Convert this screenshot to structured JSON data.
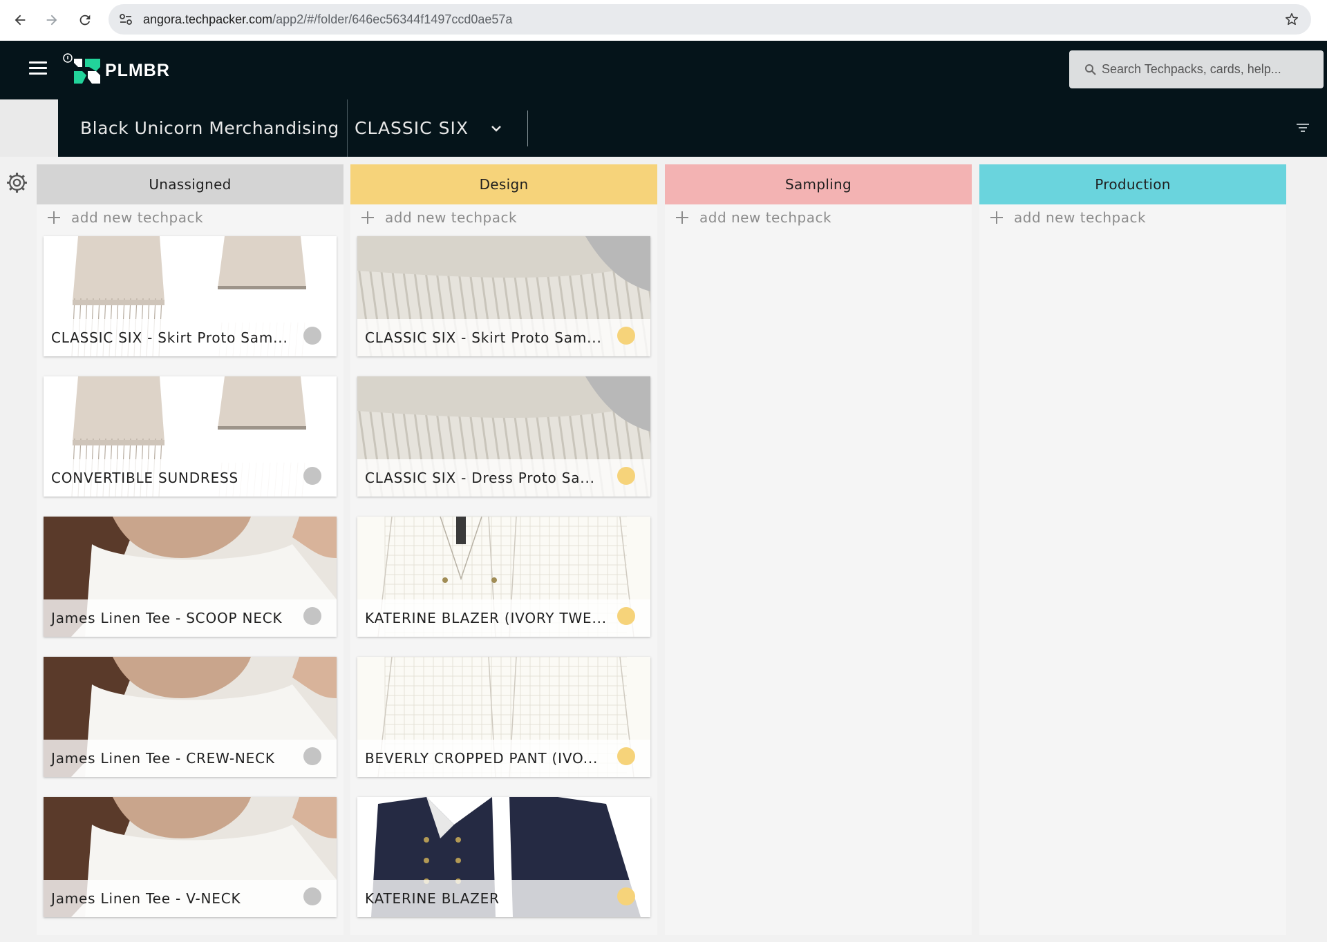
{
  "browser": {
    "url_host": "angora.techpacker.com",
    "url_path": "/app2/#/folder/646ec56344f1497ccd0ae57a"
  },
  "app": {
    "brand": "PLMBR",
    "search_placeholder": "Search Techpacks, cards, help..."
  },
  "folder": {
    "title": "Black Unicorn Merchandising",
    "collection": "CLASSIC SIX"
  },
  "colors": {
    "unassigned": "#d4d4d4",
    "design": "#f6d37a",
    "sampling": "#f3b3b3",
    "production": "#6ad4dd",
    "status_grey": "#c4c4c4",
    "status_yellow": "#f6d37a"
  },
  "add_label": "add new techpack",
  "columns": [
    {
      "label": "Unassigned",
      "cards": [
        {
          "title": "CLASSIC SIX - Skirt Proto Sam...",
          "image": "skirt-sketch"
        },
        {
          "title": "CONVERTIBLE SUNDRESS",
          "image": "dress-sketch"
        },
        {
          "title": "James Linen Tee - SCOOP NECK",
          "image": "photo-tee"
        },
        {
          "title": "James Linen Tee - CREW-NECK",
          "image": "photo-tee"
        },
        {
          "title": "James Linen Tee - V-NECK",
          "image": "photo-tee"
        }
      ]
    },
    {
      "label": "Design",
      "cards": [
        {
          "title": "CLASSIC SIX - Skirt Proto Sam...",
          "image": "photo-pleats"
        },
        {
          "title": "CLASSIC SIX - Dress Proto Sa...",
          "image": "photo-pleats"
        },
        {
          "title": "KATERINE BLAZER (IVORY TWE...",
          "image": "blazer-ivory"
        },
        {
          "title": "BEVERLY CROPPED PANT (IVO...",
          "image": "pant-ivory"
        },
        {
          "title": "KATERINE BLAZER",
          "image": "blazer-navy"
        }
      ]
    },
    {
      "label": "Sampling",
      "cards": []
    },
    {
      "label": "Production",
      "cards": []
    }
  ]
}
